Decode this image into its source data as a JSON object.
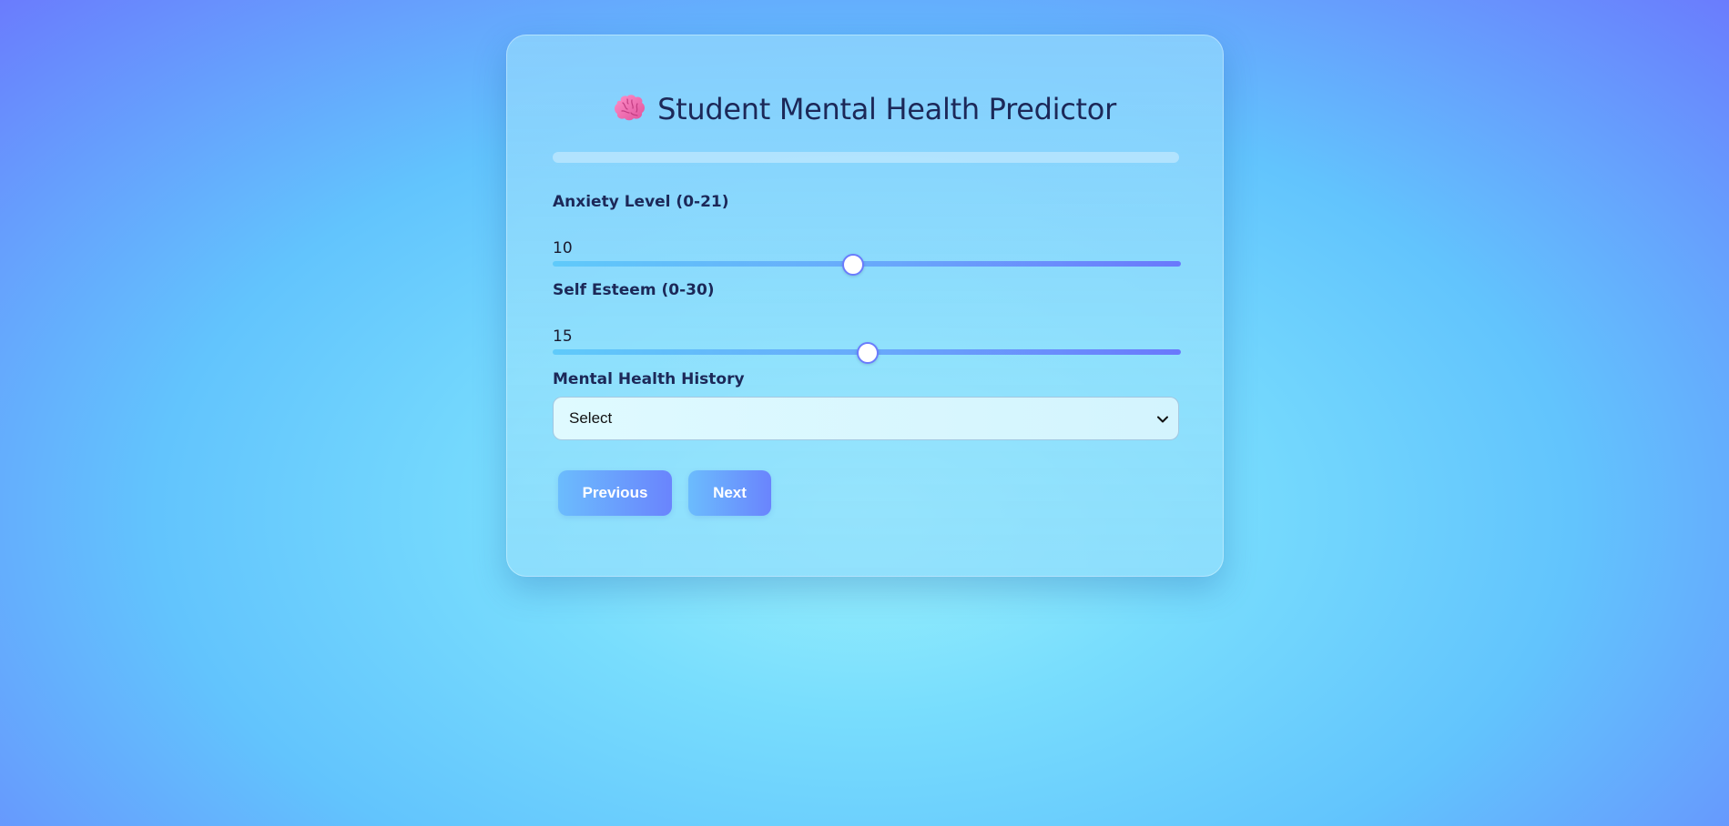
{
  "header": {
    "icon": "brain-icon",
    "title": "Student Mental Health Predictor"
  },
  "progress": {
    "percent": 0
  },
  "fields": {
    "anxiety": {
      "label": "Anxiety Level (0-21)",
      "min": 0,
      "max": 21,
      "value": "10"
    },
    "self_esteem": {
      "label": "Self Esteem (0-30)",
      "min": 0,
      "max": 30,
      "value": "15"
    },
    "history": {
      "label": "Mental Health History",
      "selected": "Select"
    }
  },
  "buttons": {
    "previous": "Previous",
    "next": "Next"
  },
  "colors": {
    "accent": "#6a7cfd",
    "accent_light": "#5fcafa",
    "title_text": "#1c2858"
  }
}
